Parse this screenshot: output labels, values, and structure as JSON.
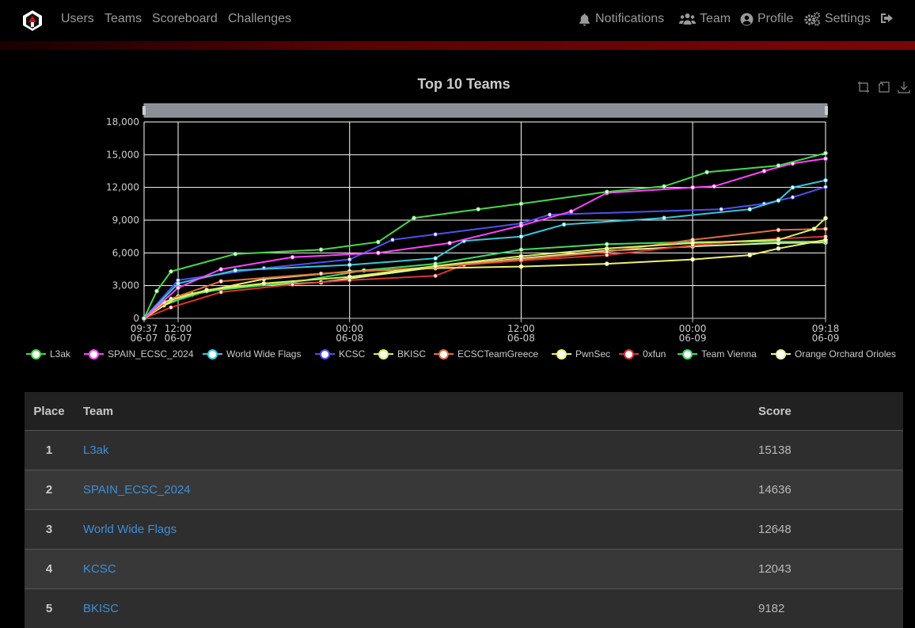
{
  "nav": {
    "left": [
      "Users",
      "Teams",
      "Scoreboard",
      "Challenges"
    ],
    "right": [
      {
        "label": "Notifications",
        "icon": "bell-icon"
      },
      {
        "label": "Team",
        "icon": "users-icon"
      },
      {
        "label": "Profile",
        "icon": "user-circle-icon"
      },
      {
        "label": "Settings",
        "icon": "cogs-icon"
      },
      {
        "label": "",
        "icon": "sign-out-icon"
      }
    ]
  },
  "toolbox": [
    "zoom-icon",
    "zoom-reset-icon",
    "download-icon"
  ],
  "colors": {
    "accent": "#7a0606",
    "link": "#3d8ed8"
  },
  "chart_data": {
    "type": "line",
    "title": "Top 10 Teams",
    "xlabel": "",
    "ylabel": "",
    "x_ticks": [
      {
        "time": "06-07 09:37",
        "label": [
          "09:37",
          "06-07"
        ]
      },
      {
        "time": "06-07 12:00",
        "label": [
          "12:00",
          "06-07"
        ]
      },
      {
        "time": "06-08 00:00",
        "label": [
          "00:00",
          "06-08"
        ]
      },
      {
        "time": "06-08 12:00",
        "label": [
          "12:00",
          "06-08"
        ]
      },
      {
        "time": "06-09 00:00",
        "label": [
          "00:00",
          "06-09"
        ]
      },
      {
        "time": "06-09 09:18",
        "label": [
          "09:18",
          "06-09"
        ]
      }
    ],
    "ylim": [
      0,
      18000
    ],
    "y_ticks": [
      "0",
      "3,000",
      "6,000",
      "9,000",
      "12,000",
      "15,000",
      "18,000"
    ],
    "grid": true,
    "legend_position": "bottom",
    "series": [
      {
        "name": "L3ak",
        "color": "#49d849",
        "points": [
          [
            "06-07 09:37",
            0
          ],
          [
            "06-07 10:30",
            2500
          ],
          [
            "06-07 11:30",
            4300
          ],
          [
            "06-07 16:00",
            5900
          ],
          [
            "06-07 22:00",
            6300
          ],
          [
            "06-08 02:00",
            7000
          ],
          [
            "06-08 04:30",
            9200
          ],
          [
            "06-08 09:00",
            10000
          ],
          [
            "06-08 12:00",
            10500
          ],
          [
            "06-08 18:00",
            11600
          ],
          [
            "06-08 22:00",
            12100
          ],
          [
            "06-09 01:00",
            13400
          ],
          [
            "06-09 06:00",
            14000
          ],
          [
            "06-09 09:18",
            15138
          ]
        ]
      },
      {
        "name": "SPAIN_ECSC_2024",
        "color": "#ff44ff",
        "points": [
          [
            "06-07 09:37",
            0
          ],
          [
            "06-07 12:00",
            2800
          ],
          [
            "06-07 15:00",
            4500
          ],
          [
            "06-07 20:00",
            5600
          ],
          [
            "06-08 02:00",
            6000
          ],
          [
            "06-08 07:00",
            6900
          ],
          [
            "06-08 12:00",
            8500
          ],
          [
            "06-08 15:30",
            9800
          ],
          [
            "06-08 18:00",
            11500
          ],
          [
            "06-09 00:00",
            12000
          ],
          [
            "06-09 01:30",
            12100
          ],
          [
            "06-09 05:00",
            13500
          ],
          [
            "06-09 07:00",
            14200
          ],
          [
            "06-09 09:18",
            14636
          ]
        ]
      },
      {
        "name": "World Wide Flags",
        "color": "#37c8dd",
        "points": [
          [
            "06-07 09:37",
            0
          ],
          [
            "06-07 12:00",
            3200
          ],
          [
            "06-07 16:00",
            4400
          ],
          [
            "06-08 00:00",
            4900
          ],
          [
            "06-08 06:00",
            5500
          ],
          [
            "06-08 08:00",
            7100
          ],
          [
            "06-08 12:00",
            7500
          ],
          [
            "06-08 15:00",
            8600
          ],
          [
            "06-08 22:00",
            9200
          ],
          [
            "06-09 04:00",
            10000
          ],
          [
            "06-09 06:00",
            10800
          ],
          [
            "06-09 07:00",
            12000
          ],
          [
            "06-09 09:18",
            12648
          ]
        ]
      },
      {
        "name": "KCSC",
        "color": "#5050ee",
        "points": [
          [
            "06-07 09:37",
            0
          ],
          [
            "06-07 12:00",
            3500
          ],
          [
            "06-07 18:00",
            4600
          ],
          [
            "06-08 00:00",
            5400
          ],
          [
            "06-08 03:00",
            7200
          ],
          [
            "06-08 06:00",
            7700
          ],
          [
            "06-08 12:00",
            8700
          ],
          [
            "06-08 14:00",
            9500
          ],
          [
            "06-09 02:00",
            10000
          ],
          [
            "06-09 05:00",
            10500
          ],
          [
            "06-09 07:00",
            11100
          ],
          [
            "06-09 09:18",
            12043
          ]
        ]
      },
      {
        "name": "BKISC",
        "color": "#d8f060",
        "points": [
          [
            "06-07 09:37",
            0
          ],
          [
            "06-07 11:00",
            1500
          ],
          [
            "06-07 14:00",
            2600
          ],
          [
            "06-07 18:00",
            3200
          ],
          [
            "06-08 00:00",
            3800
          ],
          [
            "06-08 06:00",
            4800
          ],
          [
            "06-08 12:00",
            5700
          ],
          [
            "06-08 18:00",
            6400
          ],
          [
            "06-09 00:00",
            6900
          ],
          [
            "06-09 06:00",
            7200
          ],
          [
            "06-09 08:30",
            8200
          ],
          [
            "06-09 09:18",
            9182
          ]
        ]
      },
      {
        "name": "ECSCTeamGreece",
        "color": "#e07040",
        "points": [
          [
            "06-07 09:37",
            0
          ],
          [
            "06-07 11:30",
            1800
          ],
          [
            "06-07 15:00",
            3400
          ],
          [
            "06-07 22:00",
            4100
          ],
          [
            "06-08 06:00",
            4700
          ],
          [
            "06-08 12:00",
            5400
          ],
          [
            "06-08 18:00",
            6100
          ],
          [
            "06-09 00:00",
            7200
          ],
          [
            "06-09 06:00",
            8100
          ],
          [
            "06-09 09:18",
            8200
          ]
        ]
      },
      {
        "name": "PwnSec",
        "color": "#f0f070",
        "points": [
          [
            "06-07 09:37",
            0
          ],
          [
            "06-07 12:00",
            2000
          ],
          [
            "06-07 18:00",
            3600
          ],
          [
            "06-08 00:00",
            4300
          ],
          [
            "06-08 06:00",
            4600
          ],
          [
            "06-08 12:00",
            4750
          ],
          [
            "06-08 18:00",
            5000
          ],
          [
            "06-09 00:00",
            5400
          ],
          [
            "06-09 04:00",
            5800
          ],
          [
            "06-09 06:00",
            6400
          ],
          [
            "06-09 09:18",
            7200
          ]
        ]
      },
      {
        "name": "0xfun",
        "color": "#dd3333",
        "points": [
          [
            "06-07 09:37",
            0
          ],
          [
            "06-07 11:30",
            1000
          ],
          [
            "06-07 15:00",
            2400
          ],
          [
            "06-07 20:00",
            3100
          ],
          [
            "06-08 00:00",
            3500
          ],
          [
            "06-08 06:00",
            3900
          ],
          [
            "06-08 08:00",
            4900
          ],
          [
            "06-08 12:00",
            5300
          ],
          [
            "06-08 18:00",
            5800
          ],
          [
            "06-09 00:00",
            6700
          ],
          [
            "06-09 06:00",
            7300
          ],
          [
            "06-09 09:18",
            7500
          ]
        ]
      },
      {
        "name": "Team Vienna",
        "color": "#40dd60",
        "points": [
          [
            "06-07 09:37",
            0
          ],
          [
            "06-07 11:00",
            1300
          ],
          [
            "06-07 14:00",
            2500
          ],
          [
            "06-07 20:00",
            3300
          ],
          [
            "06-08 01:00",
            4400
          ],
          [
            "06-08 06:00",
            5000
          ],
          [
            "06-08 12:00",
            6300
          ],
          [
            "06-08 18:00",
            6800
          ],
          [
            "06-09 00:00",
            7000
          ],
          [
            "06-09 09:18",
            7050
          ]
        ]
      },
      {
        "name": "Orange Orchard Orioles",
        "color": "#e8f5a0",
        "points": [
          [
            "06-07 09:37",
            0
          ],
          [
            "06-07 11:00",
            1200
          ],
          [
            "06-07 13:00",
            2200
          ],
          [
            "06-07 16:00",
            2900
          ],
          [
            "06-07 22:00",
            3300
          ],
          [
            "06-08 06:00",
            4700
          ],
          [
            "06-08 12:00",
            5500
          ],
          [
            "06-08 18:00",
            6200
          ],
          [
            "06-09 00:00",
            6600
          ],
          [
            "06-09 06:00",
            6900
          ],
          [
            "06-09 09:18",
            6950
          ]
        ]
      }
    ]
  },
  "table": {
    "headers": [
      "Place",
      "Team",
      "Score"
    ],
    "rows": [
      {
        "place": "1",
        "team": "L3ak",
        "score": "15138"
      },
      {
        "place": "2",
        "team": "SPAIN_ECSC_2024",
        "score": "14636"
      },
      {
        "place": "3",
        "team": "World Wide Flags",
        "score": "12648"
      },
      {
        "place": "4",
        "team": "KCSC",
        "score": "12043"
      },
      {
        "place": "5",
        "team": "BKISC",
        "score": "9182"
      }
    ]
  }
}
